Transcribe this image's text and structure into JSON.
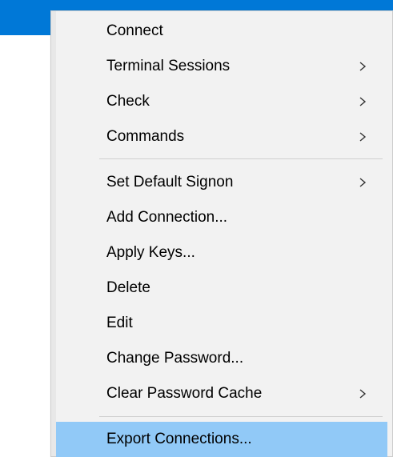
{
  "menu": {
    "items": [
      {
        "label": "Connect",
        "submenu": false
      },
      {
        "label": "Terminal Sessions",
        "submenu": true
      },
      {
        "label": "Check",
        "submenu": true
      },
      {
        "label": "Commands",
        "submenu": true
      },
      {
        "label": "Set Default Signon",
        "submenu": true
      },
      {
        "label": "Add Connection...",
        "submenu": false
      },
      {
        "label": "Apply Keys...",
        "submenu": false
      },
      {
        "label": "Delete",
        "submenu": false
      },
      {
        "label": "Edit",
        "submenu": false
      },
      {
        "label": "Change Password...",
        "submenu": false
      },
      {
        "label": "Clear Password Cache",
        "submenu": true
      },
      {
        "label": "Export Connections...",
        "submenu": false,
        "highlighted": true
      }
    ]
  },
  "colors": {
    "title_bar": "#0078d7",
    "menu_background": "#f2f2f2",
    "highlight": "#91c9f7"
  },
  "icons": {
    "submenu": "chevron-right-icon"
  }
}
